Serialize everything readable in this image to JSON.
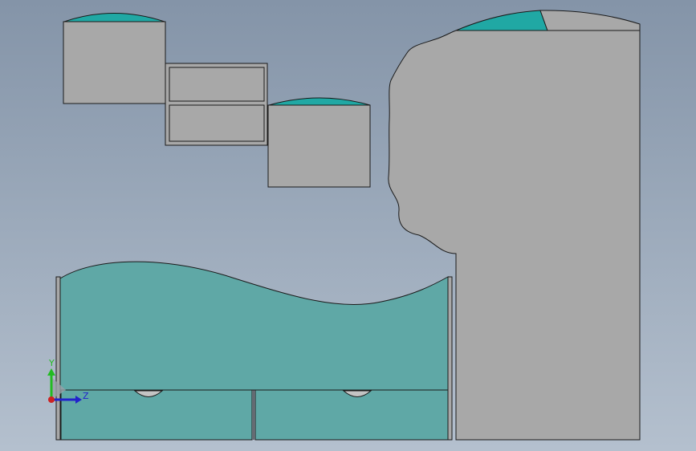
{
  "viewport": {
    "background_top": "#8494a8",
    "background_bottom": "#b4c0ce"
  },
  "colors": {
    "face_gray": "#a8a8a8",
    "face_teal": "#5fa8a6",
    "cap_teal": "#20a8a4",
    "edge": "#1a1a1a"
  },
  "triad": {
    "y_label": "Y",
    "z_label": "Z",
    "y_color": "#22bb22",
    "z_color": "#2222cc",
    "origin_color": "#cc2222"
  }
}
